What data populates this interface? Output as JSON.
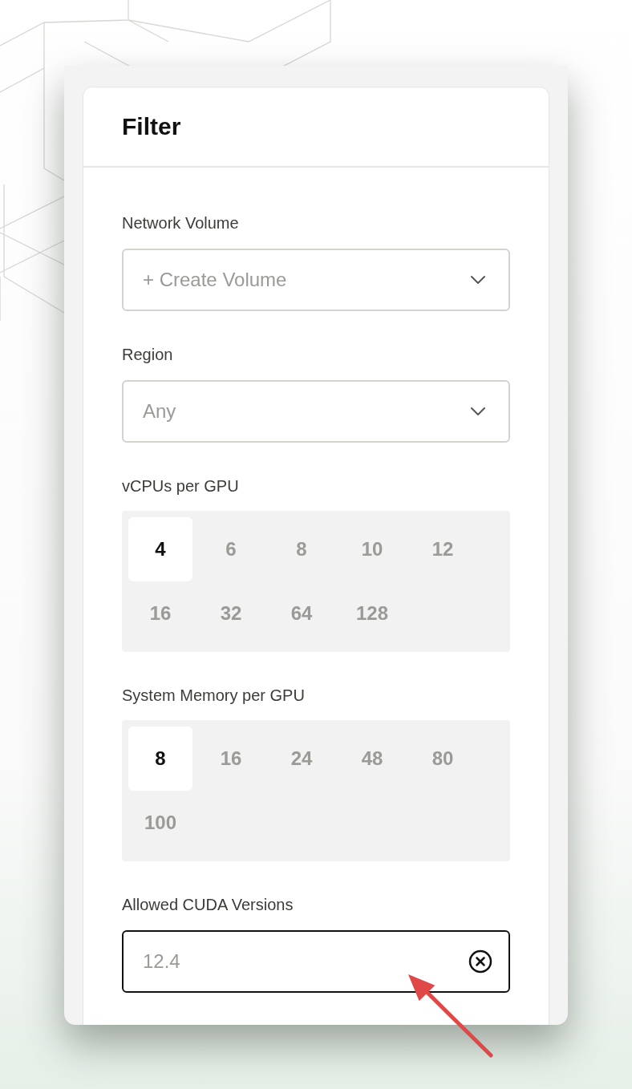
{
  "panel": {
    "title": "Filter"
  },
  "fields": [
    {
      "kind": "select",
      "label": "Network Volume",
      "placeholder": "+ Create Volume"
    },
    {
      "kind": "select",
      "label": "Region",
      "placeholder": "Any"
    },
    {
      "kind": "chips",
      "label": "vCPUs per GPU",
      "options": [
        {
          "label": "4",
          "selected": true
        },
        {
          "label": "6",
          "selected": false
        },
        {
          "label": "8",
          "selected": false
        },
        {
          "label": "10",
          "selected": false
        },
        {
          "label": "12",
          "selected": false
        },
        {
          "label": "16",
          "selected": false
        },
        {
          "label": "32",
          "selected": false
        },
        {
          "label": "64",
          "selected": false
        },
        {
          "label": "128",
          "selected": false
        }
      ]
    },
    {
      "kind": "chips",
      "label": "System Memory per GPU",
      "options": [
        {
          "label": "8",
          "selected": true
        },
        {
          "label": "16",
          "selected": false
        },
        {
          "label": "24",
          "selected": false
        },
        {
          "label": "48",
          "selected": false
        },
        {
          "label": "80",
          "selected": false
        },
        {
          "label": "100",
          "selected": false
        }
      ]
    },
    {
      "kind": "input",
      "label": "Allowed CUDA Versions",
      "placeholder": "12.4",
      "focused": true
    }
  ]
}
